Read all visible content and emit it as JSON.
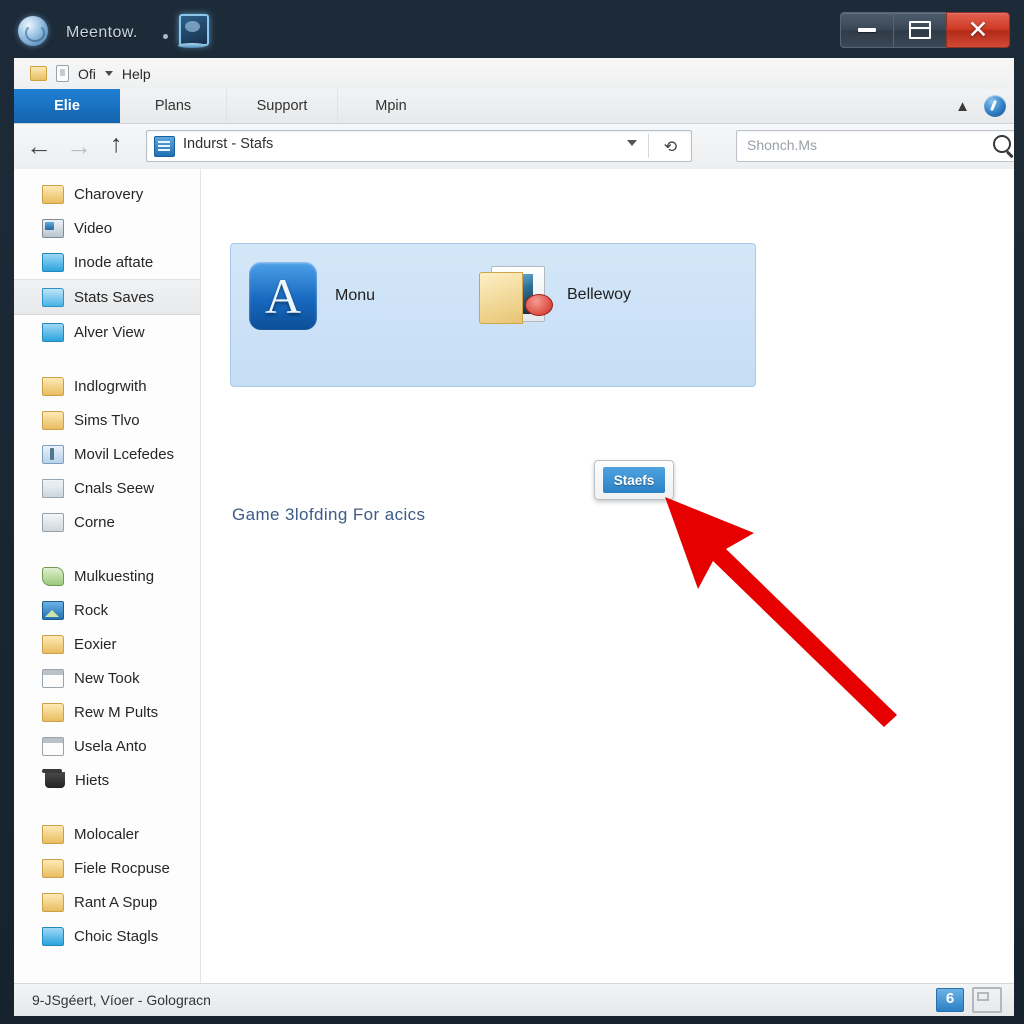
{
  "window": {
    "title": "Meentow.",
    "icon": "globe-icon",
    "secondary_icon": "monitor-icon",
    "controls": {
      "minimize": "minimize-icon",
      "maximize": "maximize-icon",
      "close": "✕"
    }
  },
  "menu": {
    "folder_icon": "folder-icon",
    "doc_icon": "document-icon",
    "label": "Ofi",
    "dropdown": "chevron-down-icon",
    "help": "Help"
  },
  "tabs": [
    {
      "label": "Elie",
      "active": true
    },
    {
      "label": "Plans",
      "active": false
    },
    {
      "label": "Support",
      "active": false
    },
    {
      "label": "Mpin",
      "active": false
    }
  ],
  "ribbon": {
    "collapse_icon": "chevron-up-icon",
    "help_icon": "help-orb-icon"
  },
  "address_bar": {
    "back_icon": "arrow-left-icon",
    "forward_icon": "arrow-right-icon",
    "up_icon": "arrow-up-icon",
    "path_icon": "library-icon",
    "path": "Indurst - Stafs",
    "dropdown_icon": "chevron-down-icon",
    "refresh_icon": "refresh-icon"
  },
  "search": {
    "placeholder": "Shonch.Ms",
    "icon": "search-icon"
  },
  "sidebar": {
    "groups": [
      {
        "items": [
          {
            "label": "Charovery",
            "icon": "folder-yellow-icon",
            "selected": false
          },
          {
            "label": "Video",
            "icon": "drive-icon",
            "selected": false
          },
          {
            "label": "Inode aftate",
            "icon": "folder-blue-icon",
            "selected": false
          },
          {
            "label": "Stats Saves",
            "icon": "folder-blue-icon",
            "selected": true
          },
          {
            "label": "Alver View",
            "icon": "folder-blue-icon",
            "selected": false
          }
        ]
      },
      {
        "items": [
          {
            "label": "Indlogrwith",
            "icon": "folder-yellow-icon",
            "selected": false
          },
          {
            "label": "Sims Tlvo",
            "icon": "folder-yellow-icon",
            "selected": false
          },
          {
            "label": "Movil Lcefedes",
            "icon": "tool-icon",
            "selected": false
          },
          {
            "label": "Cnals Seew",
            "icon": "envelope-icon",
            "selected": false
          },
          {
            "label": "Corne",
            "icon": "gray-square-icon",
            "selected": false
          }
        ]
      },
      {
        "items": [
          {
            "label": "Mulkuesting",
            "icon": "leaf-icon",
            "selected": false
          },
          {
            "label": "Rock",
            "icon": "picture-icon",
            "selected": false
          },
          {
            "label": "Eoxier",
            "icon": "folder-yellow-icon",
            "selected": false
          },
          {
            "label": "New Took",
            "icon": "calendar-icon",
            "selected": false
          },
          {
            "label": "Rew M Pults",
            "icon": "folder-yellow-icon",
            "selected": false
          },
          {
            "label": "Usela Anto",
            "icon": "calendar-icon",
            "selected": false
          },
          {
            "label": "Hiets",
            "icon": "recycle-bin-icon",
            "selected": false
          }
        ]
      },
      {
        "items": [
          {
            "label": "Molocaler",
            "icon": "folder-yellow-icon",
            "selected": false
          },
          {
            "label": "Fiele Rocpuse",
            "icon": "folder-yellow-icon",
            "selected": false
          },
          {
            "label": "Rant A Spup",
            "icon": "folder-yellow-icon",
            "selected": false
          },
          {
            "label": "Choic Stagls",
            "icon": "folder-blue-icon",
            "selected": false
          }
        ]
      }
    ]
  },
  "content": {
    "items": [
      {
        "label": "Monu",
        "icon": "app-a-icon"
      },
      {
        "label": "Bellewoy",
        "icon": "folder-picture-icon"
      }
    ],
    "tooltip_button": "Staefs",
    "caption": "Game 3lofding For acics",
    "annotation_arrow": "red-arrow-annotation"
  },
  "status": {
    "text": "9-JSgéert, Víoer - Gologracn",
    "view_buttons": [
      {
        "name": "details-view",
        "active": true
      },
      {
        "name": "icons-view",
        "active": false
      }
    ]
  },
  "colors": {
    "accent": "#1464ad",
    "selection": "#cfe3f7",
    "close_button": "#cf3a26",
    "annotation": "#e60000"
  }
}
